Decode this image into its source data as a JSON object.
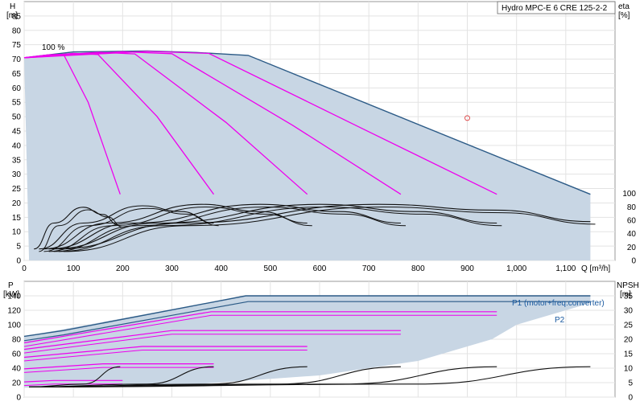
{
  "chart_data": [
    {
      "type": "line",
      "title": "Hydro MPC-E 6 CRE 125-2-2",
      "xlabel": "Q [m³/h]",
      "ylabel_left_unit": "H",
      "ylabel_left_bracket": "[m]",
      "ylabel_right_unit": "eta",
      "ylabel_right_bracket": "[%]",
      "xlim": [
        0,
        1200
      ],
      "ylim_left": [
        0,
        90
      ],
      "ylim_right": [
        0,
        100
      ],
      "grid": true,
      "x_ticks": [
        {
          "v": 0,
          "t": "0"
        },
        {
          "v": 100,
          "t": "100"
        },
        {
          "v": 200,
          "t": "200"
        },
        {
          "v": 300,
          "t": "300"
        },
        {
          "v": 400,
          "t": "400"
        },
        {
          "v": 500,
          "t": "500"
        },
        {
          "v": 600,
          "t": "600"
        },
        {
          "v": 700,
          "t": "700"
        },
        {
          "v": 800,
          "t": "800"
        },
        {
          "v": 900,
          "t": "900"
        },
        {
          "v": 1000,
          "t": "1,000"
        },
        {
          "v": 1100,
          "t": "1,100"
        }
      ],
      "y_ticks_left": [
        0,
        5,
        10,
        15,
        20,
        25,
        30,
        35,
        40,
        45,
        50,
        55,
        60,
        65,
        70,
        75,
        80,
        85
      ],
      "y_ticks_right": [
        {
          "v": 0,
          "t": "0"
        },
        {
          "v": 20,
          "t": "20"
        },
        {
          "v": 40,
          "t": "40"
        },
        {
          "v": 60,
          "t": "60"
        },
        {
          "v": 80,
          "t": "80"
        },
        {
          "v": 100,
          "t": "100"
        }
      ],
      "annotation_speed": "100 %",
      "operating_area": [
        [
          0,
          70.5
        ],
        [
          100,
          72.5
        ],
        [
          250,
          72.8
        ],
        [
          350,
          72.3
        ],
        [
          455,
          71.3
        ],
        [
          1150,
          23
        ],
        [
          1150,
          0
        ],
        [
          10,
          0
        ]
      ],
      "max_curve": [
        [
          0,
          70.5
        ],
        [
          100,
          72.5
        ],
        [
          250,
          72.8
        ],
        [
          350,
          72.3
        ],
        [
          455,
          71.3
        ],
        [
          1150,
          23
        ]
      ],
      "head_curves_per_pump_count": [
        {
          "pumps": 1,
          "points": [
            [
              0,
              70.5
            ],
            [
              50,
              71.5
            ],
            [
              80,
              71.7
            ],
            [
              130,
              55
            ],
            [
              195,
              23
            ]
          ]
        },
        {
          "pumps": 2,
          "points": [
            [
              0,
              70.5
            ],
            [
              100,
              72
            ],
            [
              150,
              71.6
            ],
            [
              270,
              50
            ],
            [
              385,
              23
            ]
          ]
        },
        {
          "pumps": 3,
          "points": [
            [
              0,
              70.5
            ],
            [
              150,
              72.4
            ],
            [
              225,
              71.8
            ],
            [
              410,
              48
            ],
            [
              575,
              23
            ]
          ]
        },
        {
          "pumps": 4,
          "points": [
            [
              0,
              70.5
            ],
            [
              200,
              72.6
            ],
            [
              300,
              71.9
            ],
            [
              545,
              47
            ],
            [
              765,
              23
            ]
          ]
        },
        {
          "pumps": 5,
          "points": [
            [
              0,
              70.5
            ],
            [
              250,
              72.7
            ],
            [
              375,
              72
            ],
            [
              685,
              46
            ],
            [
              960,
              23
            ]
          ]
        }
      ],
      "duty_point": {
        "x": 900,
        "y": 49.5
      },
      "efficiency_curves": [
        {
          "x_end": 195,
          "points": [
            [
              20,
              4
            ],
            [
              60,
              13
            ],
            [
              120,
              18.5
            ],
            [
              160,
              16
            ],
            [
              190,
              12.5
            ]
          ]
        },
        {
          "x_end": 385,
          "points": [
            [
              30,
              4
            ],
            [
              120,
              13
            ],
            [
              240,
              19
            ],
            [
              320,
              17
            ],
            [
              385,
              13
            ]
          ]
        },
        {
          "x_end": 575,
          "points": [
            [
              40,
              4
            ],
            [
              170,
              13
            ],
            [
              360,
              19.5
            ],
            [
              480,
              17
            ],
            [
              575,
              13
            ]
          ]
        },
        {
          "x_end": 765,
          "points": [
            [
              50,
              4
            ],
            [
              220,
              13
            ],
            [
              480,
              19.5
            ],
            [
              640,
              17
            ],
            [
              765,
              13
            ]
          ]
        },
        {
          "x_end": 960,
          "points": [
            [
              60,
              4
            ],
            [
              270,
              13
            ],
            [
              600,
              19.5
            ],
            [
              800,
              17
            ],
            [
              960,
              13
            ]
          ]
        },
        {
          "x_end": 1150,
          "points": [
            [
              70,
              4
            ],
            [
              320,
              13
            ],
            [
              720,
              19.5
            ],
            [
              960,
              17.5
            ],
            [
              1150,
              13.5
            ]
          ]
        }
      ]
    },
    {
      "type": "line",
      "ylabel_left_unit": "P",
      "ylabel_left_bracket": "[kW]",
      "ylabel_right_unit": "NPSH",
      "ylabel_right_bracket": "[m]",
      "xlim": [
        0,
        1200
      ],
      "ylim_left": [
        0,
        160
      ],
      "ylim_right": [
        0,
        40
      ],
      "grid": true,
      "y_ticks_left": [
        0,
        20,
        40,
        60,
        80,
        100,
        120,
        140
      ],
      "y_ticks_right": [
        0,
        5,
        10,
        15,
        20,
        25,
        30,
        35
      ],
      "label_p1": "P1 (motor+freq.converter)",
      "label_p2": "P2",
      "area": [
        [
          0,
          84
        ],
        [
          450,
          140
        ],
        [
          1150,
          140
        ],
        [
          1150,
          130
        ],
        [
          1000,
          100
        ],
        [
          950,
          80
        ],
        [
          800,
          50
        ],
        [
          600,
          30
        ],
        [
          350,
          18
        ],
        [
          0,
          13
        ]
      ],
      "p1_curve": [
        [
          0,
          84
        ],
        [
          80,
          92
        ],
        [
          450,
          140
        ],
        [
          1150,
          140
        ]
      ],
      "p2_curve": [
        [
          0,
          78
        ],
        [
          80,
          86
        ],
        [
          455,
          132
        ],
        [
          1150,
          132
        ]
      ],
      "power_curves": [
        {
          "x_end": 195,
          "points": [
            [
              0,
              21
            ],
            [
              60,
              23
            ],
            [
              200,
              23
            ]
          ]
        },
        {
          "x_end": 385,
          "points": [
            [
              0,
              39
            ],
            [
              160,
              46
            ],
            [
              385,
              46
            ]
          ]
        },
        {
          "x_end": 575,
          "points": [
            [
              0,
              55
            ],
            [
              240,
              70
            ],
            [
              575,
              70
            ]
          ]
        },
        {
          "x_end": 765,
          "points": [
            [
              0,
              66
            ],
            [
              300,
              92
            ],
            [
              765,
              92
            ]
          ]
        },
        {
          "x_end": 960,
          "points": [
            [
              0,
              75
            ],
            [
              380,
              118
            ],
            [
              960,
              118
            ]
          ]
        }
      ],
      "npsh_curves": [
        {
          "points": [
            [
              10,
              3.5
            ],
            [
              120,
              4.5
            ],
            [
              195,
              10.5
            ]
          ]
        },
        {
          "points": [
            [
              10,
              3.5
            ],
            [
              250,
              4.5
            ],
            [
              385,
              10.5
            ]
          ]
        },
        {
          "points": [
            [
              10,
              3.5
            ],
            [
              380,
              4.5
            ],
            [
              575,
              10.5
            ]
          ]
        },
        {
          "points": [
            [
              10,
              3.5
            ],
            [
              520,
              4.5
            ],
            [
              765,
              10.5
            ]
          ]
        },
        {
          "points": [
            [
              10,
              3.5
            ],
            [
              650,
              4.5
            ],
            [
              960,
              10.5
            ]
          ]
        },
        {
          "points": [
            [
              10,
              3.5
            ],
            [
              800,
              4.5
            ],
            [
              1150,
              10.5
            ]
          ]
        }
      ]
    }
  ]
}
